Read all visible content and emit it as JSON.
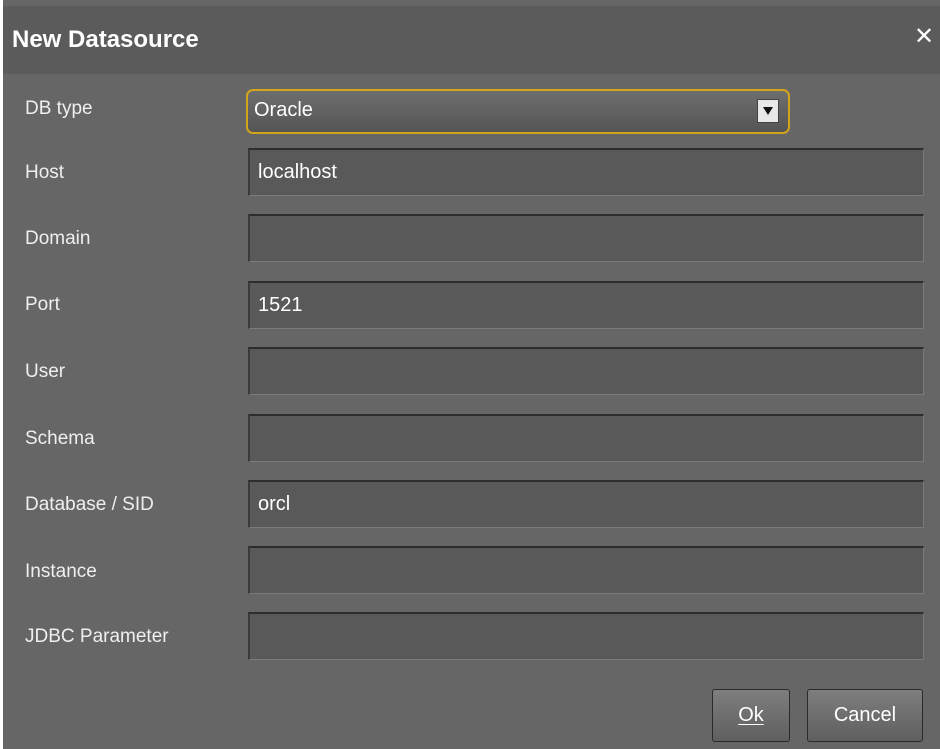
{
  "dialog": {
    "title": "New Datasource",
    "close_icon": "close-icon"
  },
  "db_type": {
    "label": "DB type",
    "value": "Oracle",
    "icon": "dropdown-arrow-icon",
    "accent_color": "#d4a51a"
  },
  "fields": {
    "host": {
      "label": "Host",
      "value": "localhost"
    },
    "domain": {
      "label": "Domain",
      "value": ""
    },
    "port": {
      "label": "Port",
      "value": "1521"
    },
    "user": {
      "label": "User",
      "value": ""
    },
    "schema": {
      "label": "Schema",
      "value": ""
    },
    "database_sid": {
      "label": "Database / SID",
      "value": "orcl"
    },
    "instance": {
      "label": "Instance",
      "value": ""
    },
    "jdbc_parameter": {
      "label": "JDBC Parameter",
      "value": ""
    }
  },
  "buttons": {
    "ok_label": "Ok",
    "cancel_label": "Cancel"
  }
}
